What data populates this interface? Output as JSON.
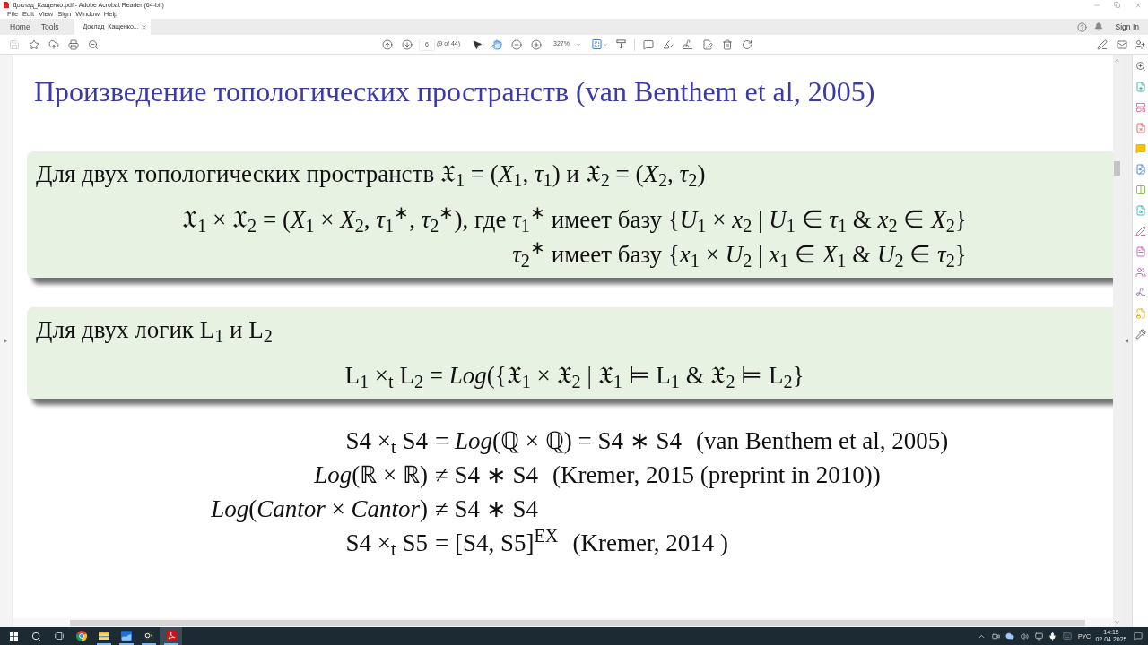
{
  "window": {
    "title": "Доклад_Кащенко.pdf - Adobe Acrobat Reader (64-bit)"
  },
  "menu": [
    "File",
    "Edit",
    "View",
    "Sign",
    "Window",
    "Help"
  ],
  "tabs": [
    {
      "label": "Home",
      "selected": false,
      "closable": false
    },
    {
      "label": "Tools",
      "selected": false,
      "closable": false
    },
    {
      "label": "Доклад_Кащенко...",
      "selected": true,
      "closable": true
    }
  ],
  "account": {
    "sign_in": "Sign In"
  },
  "toolbar": {
    "quick_tools": [
      {
        "kind": "save",
        "disabled": true
      },
      {
        "kind": "star",
        "disabled": false
      },
      {
        "kind": "upload",
        "disabled": false
      },
      {
        "kind": "print",
        "disabled": false
      },
      {
        "kind": "zoom_out",
        "disabled": false
      }
    ],
    "page_number": "6",
    "page_count": "(9 of 44)",
    "tools": [
      {
        "kind": "select",
        "selected": false
      },
      {
        "kind": "hand",
        "selected": true
      }
    ],
    "zoom": "327%"
  },
  "document": {
    "title": "Произведение топологических пространств (van Benthem et al, 2005)",
    "blocks": [
      {
        "intro": "Для двух топологических пространств 𝔛$_{1}$ = (*X*$_{1}$, *τ*$_{1}$) и 𝔛$_{2}$ = (*X*$_{2}$, *τ*$_{2}$)",
        "formula_lines": [
          "𝔛$_{1}$ × 𝔛$_{2}$ = (*X*$_{1}$ × *X*$_{2}$, *τ*$_{1}$$^{∗}$, *τ*$_{2}$$^{∗}$),  где *τ*$_{1}$$^{∗}$ имеет базу {*U*$_{1}$ × *x*$_{2}$ | *U*$_{1}$ ∈ *τ*$_{1}$ & *x*$_{2}$ ∈ *X*$_{2}$}",
          "*τ*$_{2}$$^{∗}$ имеет базу {*x*$_{1}$ × *U*$_{2}$ | *x*$_{1}$ ∈ *X*$_{1}$ & *U*$_{2}$ ∈ *τ*$_{2}$}"
        ]
      },
      {
        "intro": "Для двух логик L$_{1}$ и L$_{2}$",
        "formula_lines": [
          "L$_{1}$ ×$_{t}$ L$_{2}$ = *Log*({𝔛$_{1}$ × 𝔛$_{2}$ | 𝔛$_{1}$ ⊨ L$_{1}$ & 𝔛$_{2}$ ⊨ L$_{2}$}"
        ]
      }
    ],
    "results": [
      {
        "lhs": "S4 ×$_{t}$ S4",
        "rhs": "= *Log*(ℚ × ℚ) = S4 ∗ S4",
        "note": "(van Benthem et al, 2005)"
      },
      {
        "lhs": "*Log*(ℝ × ℝ)",
        "rhs": "≠ S4 ∗ S4",
        "note": "(Kremer, 2015 (preprint in 2010))"
      },
      {
        "lhs": "*Log*(*Cantor* × *Cantor*)",
        "rhs": "≠ S4 ∗ S4"
      },
      {
        "lhs": "S4 ×$_{t}$ S5",
        "rhs": "= [S4, S5]$^{EX}$",
        "note": "(Kremer, 2014 )"
      }
    ]
  },
  "taskbar": {
    "apps": [
      {
        "kind": "browser",
        "running": false,
        "selected": false
      },
      {
        "kind": "files",
        "running": true,
        "selected": false
      },
      {
        "kind": "mail",
        "running": true,
        "selected": false
      },
      {
        "kind": "terminal",
        "running": true,
        "selected": false
      },
      {
        "kind": "reader",
        "running": true,
        "selected": true
      }
    ],
    "language": "РУС",
    "time": "14:15",
    "date": "02.04.2025"
  }
}
